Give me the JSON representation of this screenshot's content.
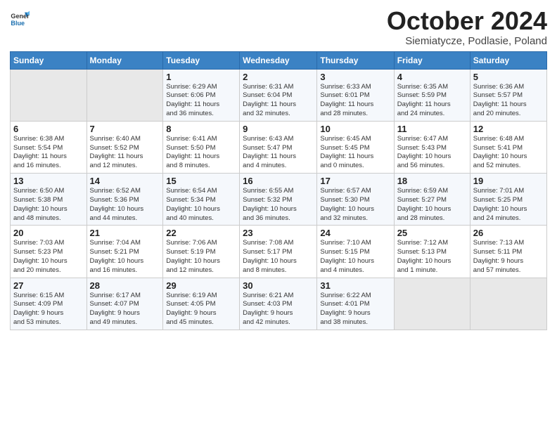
{
  "header": {
    "logo_line1": "General",
    "logo_line2": "Blue",
    "month": "October 2024",
    "location": "Siemiatycze, Podlasie, Poland"
  },
  "weekdays": [
    "Sunday",
    "Monday",
    "Tuesday",
    "Wednesday",
    "Thursday",
    "Friday",
    "Saturday"
  ],
  "weeks": [
    [
      {
        "day": "",
        "info": ""
      },
      {
        "day": "",
        "info": ""
      },
      {
        "day": "1",
        "info": "Sunrise: 6:29 AM\nSunset: 6:06 PM\nDaylight: 11 hours\nand 36 minutes."
      },
      {
        "day": "2",
        "info": "Sunrise: 6:31 AM\nSunset: 6:04 PM\nDaylight: 11 hours\nand 32 minutes."
      },
      {
        "day": "3",
        "info": "Sunrise: 6:33 AM\nSunset: 6:01 PM\nDaylight: 11 hours\nand 28 minutes."
      },
      {
        "day": "4",
        "info": "Sunrise: 6:35 AM\nSunset: 5:59 PM\nDaylight: 11 hours\nand 24 minutes."
      },
      {
        "day": "5",
        "info": "Sunrise: 6:36 AM\nSunset: 5:57 PM\nDaylight: 11 hours\nand 20 minutes."
      }
    ],
    [
      {
        "day": "6",
        "info": "Sunrise: 6:38 AM\nSunset: 5:54 PM\nDaylight: 11 hours\nand 16 minutes."
      },
      {
        "day": "7",
        "info": "Sunrise: 6:40 AM\nSunset: 5:52 PM\nDaylight: 11 hours\nand 12 minutes."
      },
      {
        "day": "8",
        "info": "Sunrise: 6:41 AM\nSunset: 5:50 PM\nDaylight: 11 hours\nand 8 minutes."
      },
      {
        "day": "9",
        "info": "Sunrise: 6:43 AM\nSunset: 5:47 PM\nDaylight: 11 hours\nand 4 minutes."
      },
      {
        "day": "10",
        "info": "Sunrise: 6:45 AM\nSunset: 5:45 PM\nDaylight: 11 hours\nand 0 minutes."
      },
      {
        "day": "11",
        "info": "Sunrise: 6:47 AM\nSunset: 5:43 PM\nDaylight: 10 hours\nand 56 minutes."
      },
      {
        "day": "12",
        "info": "Sunrise: 6:48 AM\nSunset: 5:41 PM\nDaylight: 10 hours\nand 52 minutes."
      }
    ],
    [
      {
        "day": "13",
        "info": "Sunrise: 6:50 AM\nSunset: 5:38 PM\nDaylight: 10 hours\nand 48 minutes."
      },
      {
        "day": "14",
        "info": "Sunrise: 6:52 AM\nSunset: 5:36 PM\nDaylight: 10 hours\nand 44 minutes."
      },
      {
        "day": "15",
        "info": "Sunrise: 6:54 AM\nSunset: 5:34 PM\nDaylight: 10 hours\nand 40 minutes."
      },
      {
        "day": "16",
        "info": "Sunrise: 6:55 AM\nSunset: 5:32 PM\nDaylight: 10 hours\nand 36 minutes."
      },
      {
        "day": "17",
        "info": "Sunrise: 6:57 AM\nSunset: 5:30 PM\nDaylight: 10 hours\nand 32 minutes."
      },
      {
        "day": "18",
        "info": "Sunrise: 6:59 AM\nSunset: 5:27 PM\nDaylight: 10 hours\nand 28 minutes."
      },
      {
        "day": "19",
        "info": "Sunrise: 7:01 AM\nSunset: 5:25 PM\nDaylight: 10 hours\nand 24 minutes."
      }
    ],
    [
      {
        "day": "20",
        "info": "Sunrise: 7:03 AM\nSunset: 5:23 PM\nDaylight: 10 hours\nand 20 minutes."
      },
      {
        "day": "21",
        "info": "Sunrise: 7:04 AM\nSunset: 5:21 PM\nDaylight: 10 hours\nand 16 minutes."
      },
      {
        "day": "22",
        "info": "Sunrise: 7:06 AM\nSunset: 5:19 PM\nDaylight: 10 hours\nand 12 minutes."
      },
      {
        "day": "23",
        "info": "Sunrise: 7:08 AM\nSunset: 5:17 PM\nDaylight: 10 hours\nand 8 minutes."
      },
      {
        "day": "24",
        "info": "Sunrise: 7:10 AM\nSunset: 5:15 PM\nDaylight: 10 hours\nand 4 minutes."
      },
      {
        "day": "25",
        "info": "Sunrise: 7:12 AM\nSunset: 5:13 PM\nDaylight: 10 hours\nand 1 minute."
      },
      {
        "day": "26",
        "info": "Sunrise: 7:13 AM\nSunset: 5:11 PM\nDaylight: 9 hours\nand 57 minutes."
      }
    ],
    [
      {
        "day": "27",
        "info": "Sunrise: 6:15 AM\nSunset: 4:09 PM\nDaylight: 9 hours\nand 53 minutes."
      },
      {
        "day": "28",
        "info": "Sunrise: 6:17 AM\nSunset: 4:07 PM\nDaylight: 9 hours\nand 49 minutes."
      },
      {
        "day": "29",
        "info": "Sunrise: 6:19 AM\nSunset: 4:05 PM\nDaylight: 9 hours\nand 45 minutes."
      },
      {
        "day": "30",
        "info": "Sunrise: 6:21 AM\nSunset: 4:03 PM\nDaylight: 9 hours\nand 42 minutes."
      },
      {
        "day": "31",
        "info": "Sunrise: 6:22 AM\nSunset: 4:01 PM\nDaylight: 9 hours\nand 38 minutes."
      },
      {
        "day": "",
        "info": ""
      },
      {
        "day": "",
        "info": ""
      }
    ]
  ]
}
